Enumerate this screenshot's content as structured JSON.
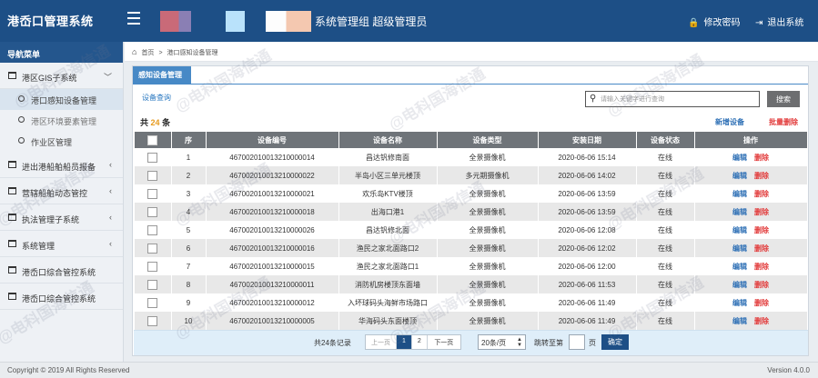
{
  "header": {
    "app_title": "港岙口管理系统",
    "org_user": "系统管理组 超级管理员",
    "change_password": "修改密码",
    "logout": "退出系统"
  },
  "sidebar": {
    "heading": "导航菜单",
    "groups": [
      {
        "label": "港区GIS子系统",
        "chevron": "﹀"
      },
      {
        "label": "进出港船舶船员报备",
        "chevron": "‹"
      },
      {
        "label": "营辖船舶动态管控",
        "chevron": "‹"
      },
      {
        "label": "执法管理子系统",
        "chevron": "‹"
      },
      {
        "label": "系统管理",
        "chevron": "‹"
      },
      {
        "label": "港岙口综合管控系统"
      },
      {
        "label": "港岙口综合管控系统"
      }
    ],
    "sub_items": [
      {
        "label": "港口感知设备管理"
      },
      {
        "label": "港区环境要素管理"
      },
      {
        "label": "作业区管理"
      }
    ]
  },
  "breadcrumb": {
    "home": "首页",
    "sep": ">",
    "current": "港口感知设备管理"
  },
  "panel": {
    "tab": "感知设备管理",
    "subtitle": "设备查询",
    "search_placeholder": "请输入关键字进行查询",
    "search_button": "搜索",
    "total_prefix": "共",
    "total_count": "24",
    "total_suffix": "条",
    "add_label": "新增设备",
    "batch_delete_label": "批量删除"
  },
  "table": {
    "columns": [
      "序",
      "设备编号",
      "设备名称",
      "设备类型",
      "安装日期",
      "设备状态",
      "操作"
    ],
    "edit_label": "编辑",
    "delete_label": "删除",
    "rows": [
      {
        "idx": "1",
        "code": "467002010013210000014",
        "name": "昌达钒修南面",
        "type": "全景摄像机",
        "date": "2020-06-06 15:14",
        "status": "在线"
      },
      {
        "idx": "2",
        "code": "467002010013210000022",
        "name": "半岛小区三单元楼顶",
        "type": "多元期摄像机",
        "date": "2020-06-06 14:02",
        "status": "在线"
      },
      {
        "idx": "3",
        "code": "467002010013210000021",
        "name": "欢乐岛KTV楼顶",
        "type": "全景摄像机",
        "date": "2020-06-06 13:59",
        "status": "在线"
      },
      {
        "idx": "4",
        "code": "467002010013210000018",
        "name": "出海口港1",
        "type": "全景摄像机",
        "date": "2020-06-06 13:59",
        "status": "在线"
      },
      {
        "idx": "5",
        "code": "467002010013210000026",
        "name": "昌达钒修北面",
        "type": "全景摄像机",
        "date": "2020-06-06 12:08",
        "status": "在线"
      },
      {
        "idx": "6",
        "code": "467002010013210000016",
        "name": "渔民之家北面路口2",
        "type": "全景摄像机",
        "date": "2020-06-06 12:02",
        "status": "在线"
      },
      {
        "idx": "7",
        "code": "467002010013210000015",
        "name": "渔民之家北面路口1",
        "type": "全景摄像机",
        "date": "2020-06-06 12:00",
        "status": "在线"
      },
      {
        "idx": "8",
        "code": "467002010013210000011",
        "name": "消防机房楼顶东面墙",
        "type": "全景摄像机",
        "date": "2020-06-06 11:53",
        "status": "在线"
      },
      {
        "idx": "9",
        "code": "467002010013210000012",
        "name": "入坏球码头海鲜市场路口",
        "type": "全景摄像机",
        "date": "2020-06-06 11:49",
        "status": "在线"
      },
      {
        "idx": "10",
        "code": "467002010013210000005",
        "name": "华海码头东面楼顶",
        "type": "全景摄像机",
        "date": "2020-06-06 11:49",
        "status": "在线"
      }
    ]
  },
  "pager": {
    "total": "共24条记录",
    "prev": "上一页",
    "pages": [
      "1",
      "2"
    ],
    "next": "下一页",
    "page_size": "20条/页",
    "jump_prefix": "跳转至第",
    "jump_suffix": "页",
    "confirm": "确定"
  },
  "footer": {
    "copyright": "Copyright © 2019 All Rights Reserved",
    "version": "Version 4.0.0"
  },
  "watermark": "@电科国海信通",
  "colors": {
    "header_bg": "#1d4f86",
    "accent_blue": "#4789c6",
    "table_header": "#6f7479",
    "delete_red": "#e23b3b",
    "edit_blue": "#2d6fb5",
    "count_orange": "#e69a1e"
  }
}
